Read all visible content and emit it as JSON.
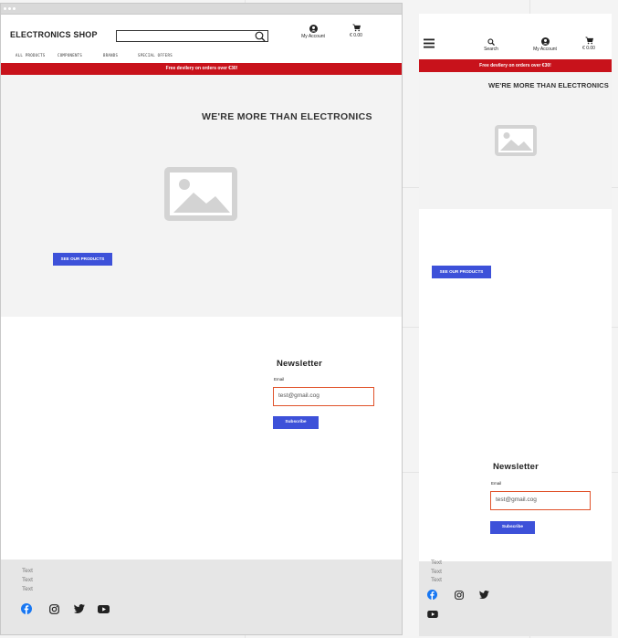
{
  "desktop": {
    "logo": "ELECTRONICS SHOP",
    "search": {
      "value": ""
    },
    "account": {
      "label": "My Account",
      "icon": "account-icon"
    },
    "cart": {
      "label": "€ 0.00",
      "icon": "cart-icon"
    },
    "nav": [
      "ALL PRODUCTS",
      "COMPONENTS",
      "BRANDS",
      "SPECIAL OFFERS"
    ],
    "banner": "Free devilery on orders over €30!",
    "hero": {
      "title": "WE'RE MORE THAN ELECTRONICS",
      "button": "SEE OUR PRODUCTS",
      "image_icon": "image-placeholder-icon"
    },
    "newsletter": {
      "title": "Newsletter",
      "email_label": "Email",
      "email_value": "test@gmail.cog",
      "button": "Subscribe"
    },
    "footer": {
      "links": [
        "Text",
        "Text",
        "Text"
      ],
      "social": [
        "facebook-icon",
        "instagram-icon",
        "twitter-icon",
        "youtube-icon"
      ]
    }
  },
  "mobile": {
    "menu_icon": "hamburger-menu-icon",
    "search_label": "Search",
    "account_label": "My Account",
    "cart_label": "€ 0.00",
    "banner": "Free devilery on orders over €30!",
    "hero": {
      "title": "WE'RE MORE THAN ELECTRONICS",
      "button": "SEE OUR PRODUCTS"
    },
    "newsletter": {
      "title": "Newsletter",
      "email_label": "Email",
      "email_value": "test@gmail.cog",
      "button": "Subscribe"
    },
    "footer": {
      "links": [
        "Text",
        "Text",
        "Text"
      ]
    }
  },
  "colors": {
    "banner": "#c8121b",
    "button": "#3d51d9",
    "input_border": "#e0522a",
    "hero_bg": "#f3f3f3",
    "footer_bg": "#e6e6e6",
    "facebook": "#1877f2"
  }
}
